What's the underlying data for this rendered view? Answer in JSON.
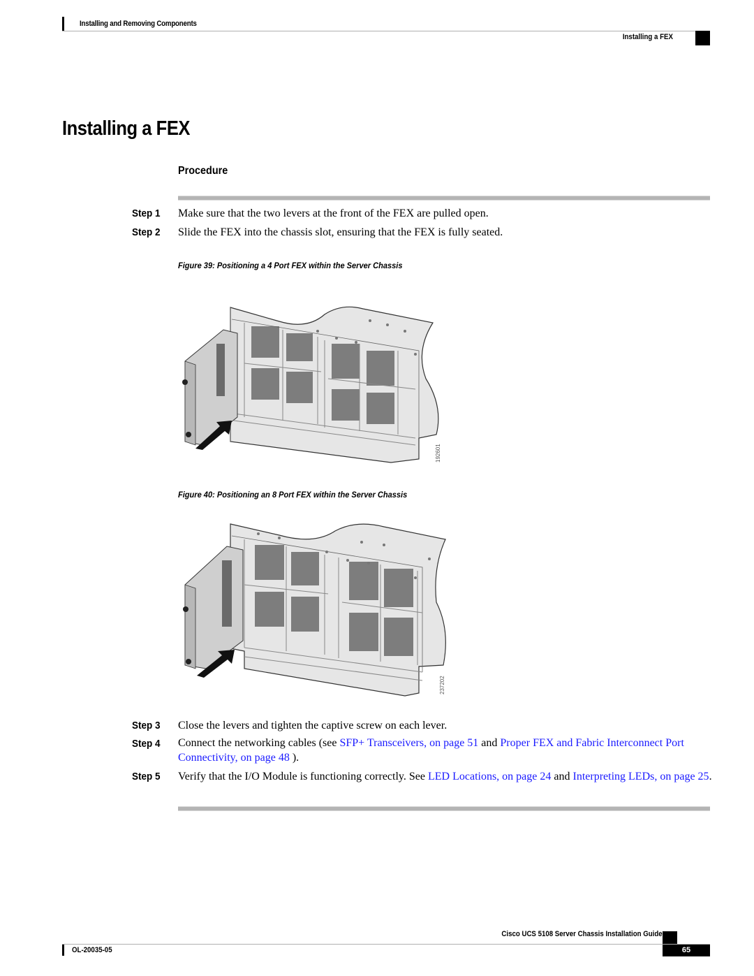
{
  "header": {
    "chapter": "Installing and Removing Components",
    "section": "Installing a FEX"
  },
  "page_title": "Installing a FEX",
  "procedure": {
    "title": "Procedure",
    "steps": [
      {
        "label": "Step 1",
        "text": "Make sure that the two levers at the front of the FEX are pulled open."
      },
      {
        "label": "Step 2",
        "text": "Slide the FEX into the chassis slot, ensuring that the FEX is fully seated."
      },
      {
        "label": "Step 3",
        "text": "Close the levers and tighten the captive screw on each lever."
      },
      {
        "label": "Step 4",
        "text_before": "Connect the networking cables (see ",
        "link1": "SFP+ Transceivers,  on page 51",
        "text_middle": " and ",
        "link2": "Proper FEX and Fabric Interconnect Port Connectivity,  on page 48",
        "text_after": " )."
      },
      {
        "label": "Step 5",
        "text_before": "Verify that the I/O Module is functioning correctly. See ",
        "link1": "LED Locations,  on page 24",
        "text_middle": " and ",
        "link2": "Interpreting LEDs,  on page 25",
        "text_after": "."
      }
    ]
  },
  "figures": [
    {
      "caption": "Figure 39: Positioning a 4 Port FEX within the Server Chassis",
      "id_label": "192601"
    },
    {
      "caption": "Figure 40: Positioning an 8 Port FEX within the Server Chassis",
      "id_label": "237202"
    }
  ],
  "footer": {
    "guide_title": "Cisco UCS 5108 Server Chassis Installation Guide",
    "doc_number": "OL-20035-05",
    "page_number": "65"
  },
  "colors": {
    "link": "#1a1aff",
    "rule": "#b4b4b4"
  }
}
